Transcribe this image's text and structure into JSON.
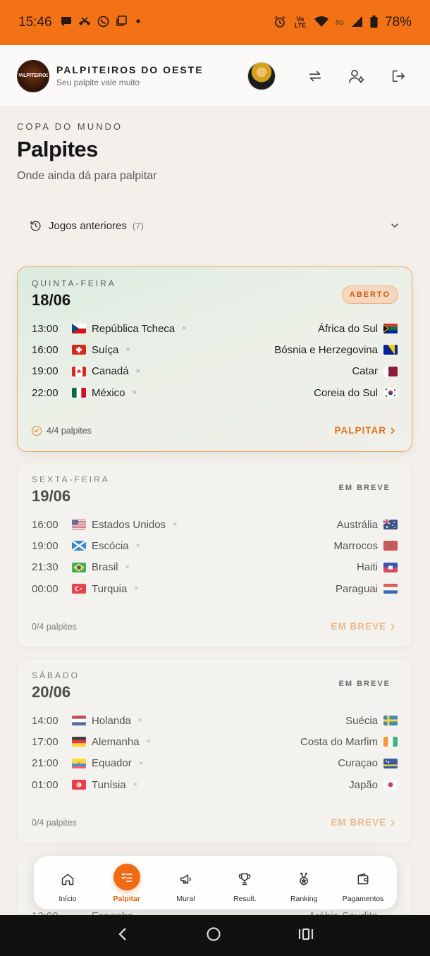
{
  "status_bar": {
    "time": "15:46",
    "battery": "78%",
    "network": "5G",
    "volte": "Vo LTE"
  },
  "header": {
    "logo_text": "PALPITEIROS",
    "title": "PALPITEIROS DO OESTE",
    "subtitle": "Seu palpite vale muito"
  },
  "page": {
    "eyebrow": "COPA DO MUNDO",
    "title": "Palpites",
    "subtitle": "Onde ainda dá para palpitar"
  },
  "previous_games": {
    "label": "Jogos anteriores",
    "count": "(7)"
  },
  "days": [
    {
      "weekday": "QUINTA-FEIRA",
      "date": "18/06",
      "status": "ABERTO",
      "progress": "4/4 palpites",
      "action": "PALPITAR",
      "matches": [
        {
          "time": "13:00",
          "home": "República Tcheca",
          "away": "África do Sul"
        },
        {
          "time": "16:00",
          "home": "Suíça",
          "away": "Bósnia e Herzegovina"
        },
        {
          "time": "19:00",
          "home": "Canadá",
          "away": "Catar"
        },
        {
          "time": "22:00",
          "home": "México",
          "away": "Coreia do Sul"
        }
      ]
    },
    {
      "weekday": "SEXTA-FEIRA",
      "date": "19/06",
      "status": "EM BREVE",
      "progress": "0/4 palpites",
      "action": "EM BREVE",
      "matches": [
        {
          "time": "16:00",
          "home": "Estados Unidos",
          "away": "Austrália"
        },
        {
          "time": "19:00",
          "home": "Escócia",
          "away": "Marrocos"
        },
        {
          "time": "21:30",
          "home": "Brasil",
          "away": "Haiti"
        },
        {
          "time": "00:00",
          "home": "Turquia",
          "away": "Paraguai"
        }
      ]
    },
    {
      "weekday": "SÁBADO",
      "date": "20/06",
      "status": "EM BREVE",
      "progress": "0/4 palpites",
      "action": "EM BREVE",
      "matches": [
        {
          "time": "14:00",
          "home": "Holanda",
          "away": "Suécia"
        },
        {
          "time": "17:00",
          "home": "Alemanha",
          "away": "Costa do Marfim"
        },
        {
          "time": "21:00",
          "home": "Equador",
          "away": "Curaçao"
        },
        {
          "time": "01:00",
          "home": "Tunísia",
          "away": "Japão"
        }
      ]
    }
  ],
  "peek_row": {
    "time": "12:00",
    "home": "Espanha",
    "away": "Arábia Saudita"
  },
  "match_separator": "×",
  "nav": [
    {
      "label": "Início",
      "icon": "home-icon"
    },
    {
      "label": "Palpitar",
      "icon": "checklist-icon",
      "active": true
    },
    {
      "label": "Mural",
      "icon": "megaphone-icon"
    },
    {
      "label": "Result.",
      "icon": "trophy-icon"
    },
    {
      "label": "Ranking",
      "icon": "medal-icon"
    },
    {
      "label": "Pagamentos",
      "icon": "wallet-icon"
    }
  ],
  "colors": {
    "accent": "#f06a14",
    "status_bar": "#f47216",
    "open_card_border": "#f0a36a"
  }
}
